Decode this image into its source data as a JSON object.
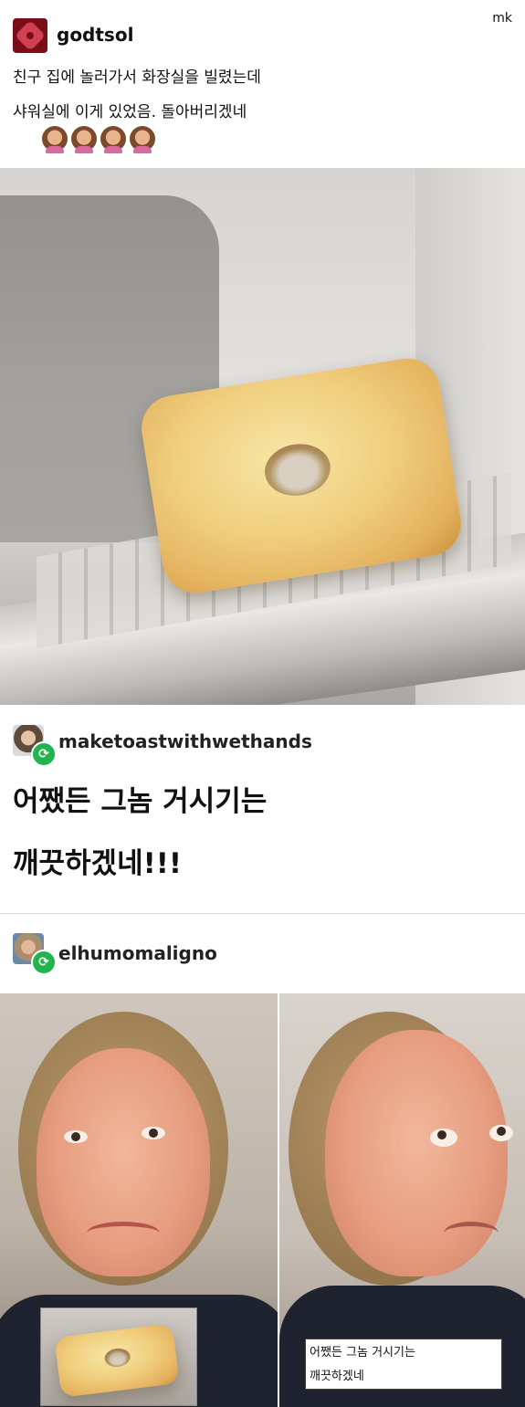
{
  "watermark": "mk",
  "posts": [
    {
      "username": "godtsol",
      "lines": [
        "친구 집에 놀러가서 화장실을 빌렸는데",
        "샤워실에 이게 있었음. 돌아버리겠네"
      ],
      "emoji": "🙎🏽‍♀️🙎🏽‍♀️🙎🏽‍♀️🙎🏽‍♀️"
    },
    {
      "username": "maketoastwithwethands",
      "lines": [
        "어쨌든 그놈 거시기는",
        "깨끗하겠네!!!"
      ]
    },
    {
      "username": "elhumomaligno"
    }
  ],
  "meme_caption": [
    "어쨌든 그놈 거시기는",
    "깨끗하겠네"
  ],
  "colors": {
    "reblog_badge": "#21b54b",
    "soap": "#f0cf7f"
  },
  "icons": {
    "reblog": "reblog-icon",
    "avatar": "avatar"
  }
}
